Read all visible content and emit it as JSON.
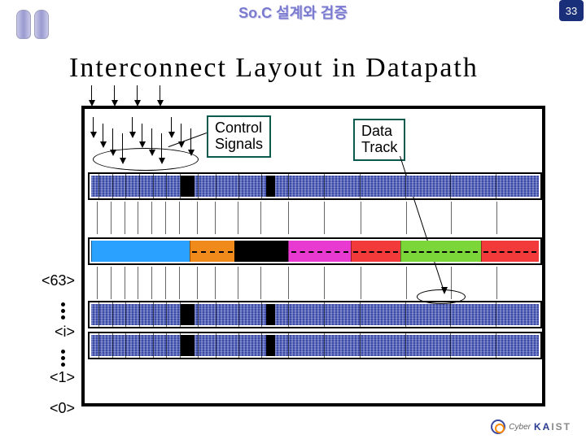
{
  "header": {
    "course_title": "So.C  설계와  검증",
    "page_number": "33"
  },
  "slide": {
    "title": "Interconnect Layout in Datapath"
  },
  "labels": {
    "control_signals_l1": "Control",
    "control_signals_l2": "Signals",
    "data_track_l1": "Data",
    "data_track_l2": "Track"
  },
  "bit_labels": {
    "b63": "<63>",
    "bi": "<i>",
    "b1": "<1>",
    "b0": "<0>"
  },
  "irow_colors": {
    "c0": "#2aa0ff",
    "c1": "#f08a1a",
    "c2": "#000000",
    "c3": "#e83ad0",
    "c4": "#f23a3a",
    "c5": "#7bd63a",
    "c6": "#f23a3a"
  },
  "footer": {
    "cyber": "Cyber",
    "kaist": "KAIST"
  }
}
